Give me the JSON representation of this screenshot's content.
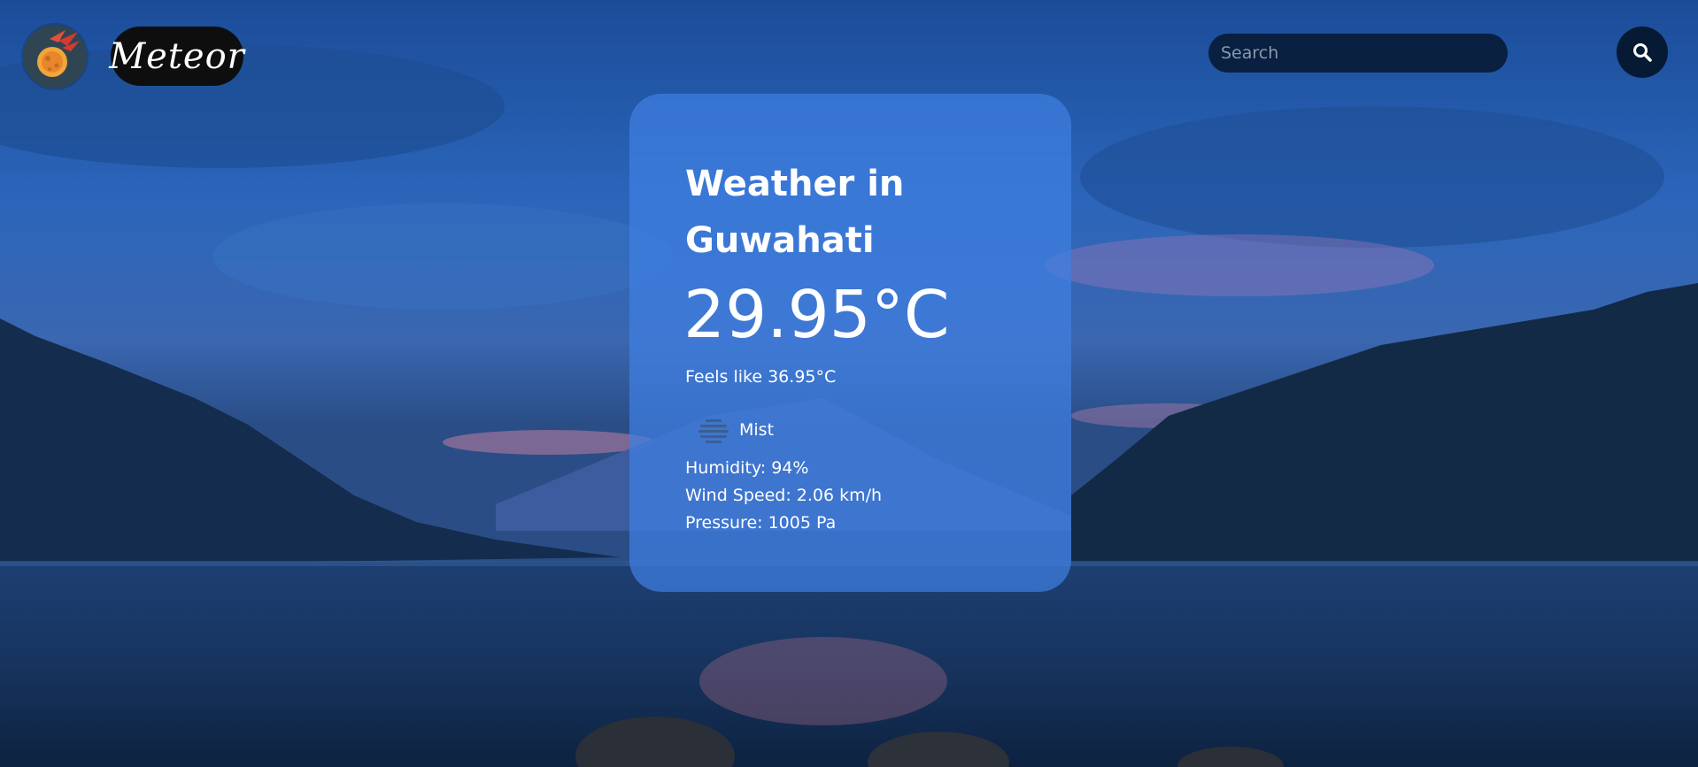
{
  "header": {
    "brand_name": "Meteor",
    "logo_icon": "meteor-icon",
    "search": {
      "placeholder": "Search",
      "value": "",
      "button_icon": "search-icon"
    }
  },
  "weather": {
    "title": "Weather in Guwahati",
    "temperature": "29.95°C",
    "feels_like": "Feels like 36.95°C",
    "condition_icon": "mist-icon",
    "condition": "Mist",
    "humidity": "Humidity: 94%",
    "wind_speed": "Wind Speed: 2.06 km/h",
    "pressure": "Pressure: 1005 Pa"
  },
  "colors": {
    "card_background": "#4080e2",
    "brand_pill": "#0e0e0e",
    "search_field": "#061830",
    "search_button": "#071a33",
    "text": "#ffffff"
  }
}
